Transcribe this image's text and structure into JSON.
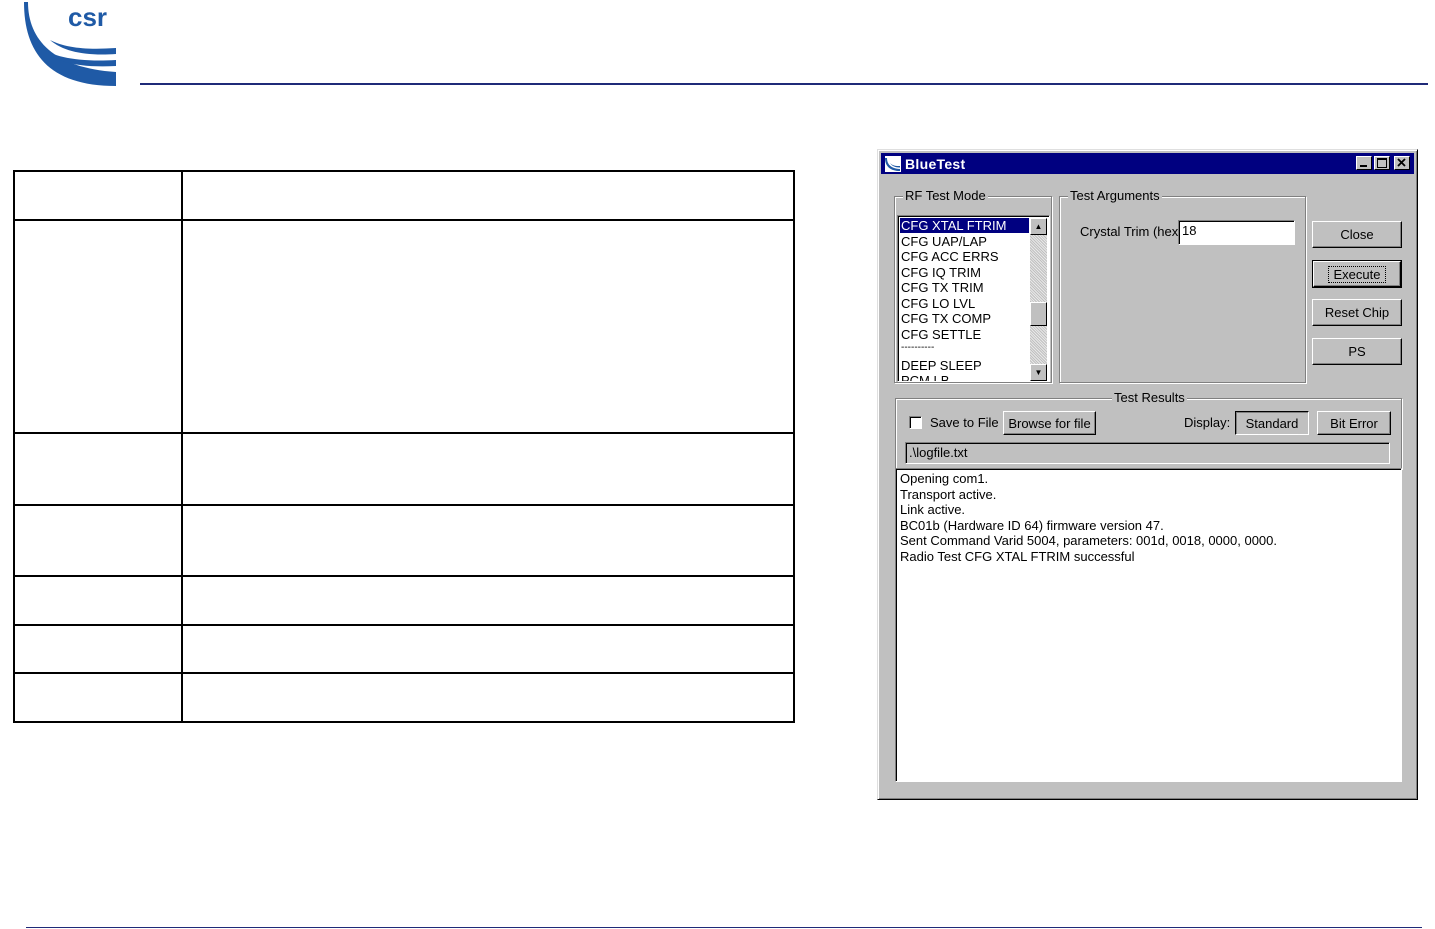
{
  "header": {
    "logo_text": "csr",
    "accent_color": "#1f2a78"
  },
  "window": {
    "title": "BlueTest",
    "rf_test_mode": {
      "legend": "RF Test Mode",
      "items": [
        "CFG XTAL FTRIM",
        "CFG UAP/LAP",
        "CFG ACC ERRS",
        "CFG IQ TRIM",
        "CFG TX TRIM",
        "CFG LO LVL",
        "CFG TX COMP",
        "CFG SETTLE",
        "----------",
        "DEEP SLEEP",
        "PCM LB"
      ],
      "selected": "CFG XTAL FTRIM"
    },
    "test_arguments": {
      "legend": "Test Arguments",
      "crystal_trim_label": "Crystal Trim (hex)",
      "crystal_trim_value": "18"
    },
    "buttons": {
      "close": "Close",
      "execute": "Execute",
      "reset_chip": "Reset Chip",
      "ps": "PS"
    },
    "test_results": {
      "legend": "Test Results",
      "save_to_file": "Save to File",
      "browse": "Browse for file",
      "display_label": "Display:",
      "standard": "Standard",
      "bit_error": "Bit Error",
      "log_path": ".\\logfile.txt"
    },
    "output_lines": [
      "Opening com1.",
      "Transport active.",
      "Link active.",
      "BC01b (Hardware ID 64) firmware version 47.",
      "Sent Command Varid 5004, parameters: 001d, 0018, 0000, 0000.",
      "Radio Test CFG XTAL FTRIM successful"
    ]
  }
}
